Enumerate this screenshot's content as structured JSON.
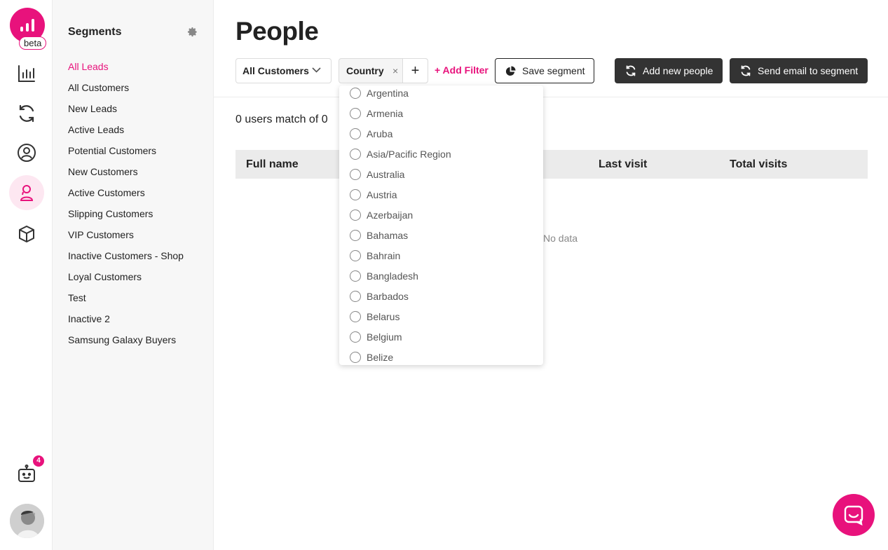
{
  "app": {
    "beta_label": "beta",
    "notification_count": "4"
  },
  "rail": {
    "icons": [
      "analytics-icon",
      "chart-bars-icon",
      "refresh-icon",
      "user-circle-icon",
      "people-icon",
      "box-icon",
      "robot-icon",
      "user-avatar"
    ]
  },
  "segments": {
    "title": "Segments",
    "items": [
      {
        "label": "All Leads",
        "active": true
      },
      {
        "label": "All Customers"
      },
      {
        "label": "New Leads"
      },
      {
        "label": "Active Leads"
      },
      {
        "label": "Potential Customers"
      },
      {
        "label": "New Customers"
      },
      {
        "label": "Active Customers"
      },
      {
        "label": "Slipping Customers"
      },
      {
        "label": "VIP Customers"
      },
      {
        "label": "Inactive Customers - Shop"
      },
      {
        "label": "Loyal Customers"
      },
      {
        "label": "Test"
      },
      {
        "label": "Inactive 2"
      },
      {
        "label": "Samsung Galaxy Buyers"
      }
    ]
  },
  "main": {
    "title": "People",
    "toolbar": {
      "customer_filter": "All Customers",
      "country_filter": "Country",
      "remove_symbol": "×",
      "plus_symbol": "+",
      "add_filter": "+ Add Filter",
      "save_segment": "Save segment",
      "add_new_people": "Add new people",
      "send_email": "Send email to segment"
    },
    "match_text": "0 users match of 0",
    "table": {
      "columns": [
        "Full name",
        "Last visit",
        "Total visits"
      ],
      "empty_text": "No data"
    }
  },
  "country_menu": {
    "options": [
      "Argentina",
      "Armenia",
      "Aruba",
      "Asia/Pacific Region",
      "Australia",
      "Austria",
      "Azerbaijan",
      "Bahamas",
      "Bahrain",
      "Bangladesh",
      "Barbados",
      "Belarus",
      "Belgium",
      "Belize"
    ]
  },
  "colors": {
    "accent": "#e8127c",
    "dark_button": "#333333",
    "sidebar_bg": "#f7f7f7"
  }
}
